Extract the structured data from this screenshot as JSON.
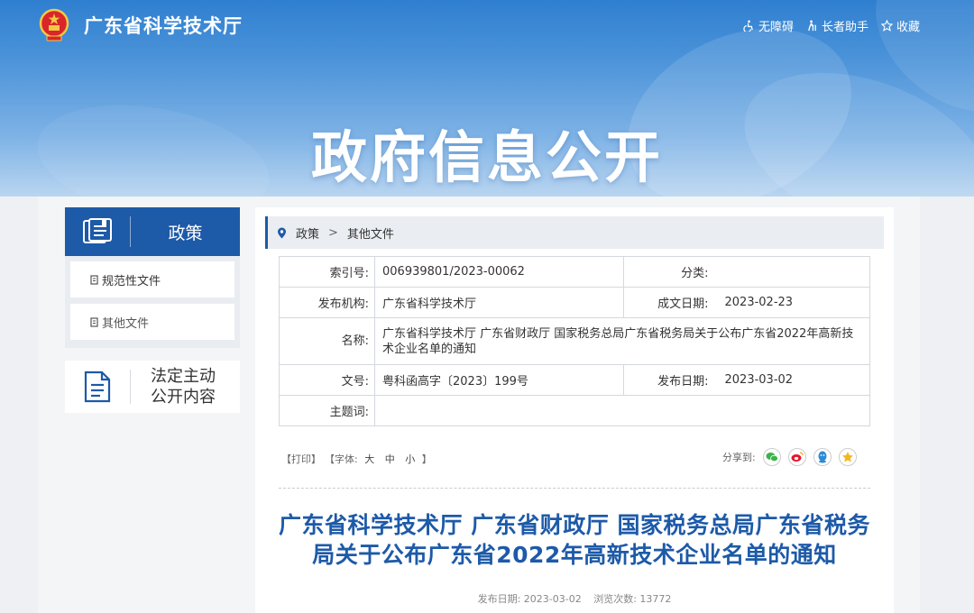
{
  "header": {
    "site_title": "广东省科学技术厅",
    "links": [
      {
        "icon": "wheelchair-icon",
        "label": "无障碍"
      },
      {
        "icon": "elder-icon",
        "label": "长者助手"
      },
      {
        "icon": "star-icon",
        "label": "收藏"
      }
    ],
    "hero": "政府信息公开"
  },
  "sidebar": {
    "section_title": "政策",
    "items": [
      {
        "label": "规范性文件",
        "icon": "document-icon"
      },
      {
        "label": "其他文件",
        "icon": "document-icon"
      }
    ],
    "law_line1": "法定主动",
    "law_line2": "公开内容"
  },
  "breadcrumb": {
    "items": [
      "政策",
      "其他文件"
    ],
    "separator": ">"
  },
  "meta": {
    "index_label": "索引号:",
    "index_value": "006939801/2023-00062",
    "category_label": "分类:",
    "category_value": "",
    "publisher_label": "发布机构:",
    "publisher_value": "广东省科学技术厅",
    "created_label": "成文日期:",
    "created_value": "2023-02-23",
    "name_label": "名称:",
    "name_value": "广东省科学技术厅 广东省财政厅 国家税务总局广东省税务局关于公布广东省2022年高新技术企业名单的通知",
    "docno_label": "文号:",
    "docno_value": "粤科函高字〔2023〕199号",
    "published_label": "发布日期:",
    "published_value": "2023-03-02",
    "subject_label": "主题词:",
    "subject_value": ""
  },
  "tools": {
    "print": "【打印】",
    "font_prefix": "【字体:",
    "font_large": "大",
    "font_medium": "中",
    "font_small": "小",
    "font_suffix": "】",
    "share_label": "分享到:",
    "share_targets": [
      "wechat-icon",
      "weibo-icon",
      "qq-icon",
      "qzone-icon"
    ]
  },
  "article": {
    "title": "广东省科学技术厅 广东省财政厅 国家税务总局广东省税务局关于公布广东省2022年高新技术企业名单的通知",
    "pub_date": "发布日期: 2023-03-02",
    "views": "浏览次数: 13772"
  },
  "colors": {
    "brand": "#1d5aa8",
    "banner_top": "#2f7fd0",
    "wechat": "#3bb34a",
    "weibo": "#e6162d",
    "qq": "#2b8bd8",
    "qzone": "#f5b51c"
  }
}
